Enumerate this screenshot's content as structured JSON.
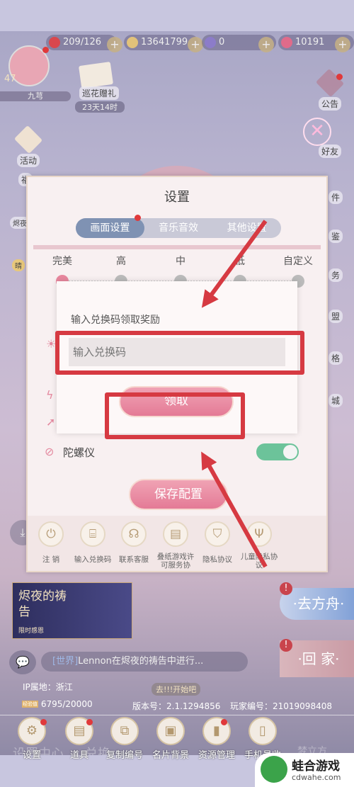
{
  "resources": {
    "stamina": "209/126",
    "gold": "13641799",
    "diamond": "0",
    "crystal": "10191"
  },
  "player": {
    "level": "47",
    "name": "九芎"
  },
  "event": {
    "label": "巡花赠礼",
    "timer": "23天14时"
  },
  "left_menu": [
    "活动",
    "福",
    "烬夜",
    "晴"
  ],
  "right_menu": [
    "公告",
    "好友",
    "件",
    "鉴",
    "务",
    "盟",
    "格",
    "城"
  ],
  "settings": {
    "title": "设置",
    "tabs": [
      "画面设置",
      "音乐音效",
      "其他设置"
    ],
    "active_tab": 0,
    "quality_levels": [
      "完美",
      "高",
      "中",
      "低",
      "自定义"
    ],
    "selected_quality": 0,
    "gyro_label": "陀螺仪",
    "gyro_on": true,
    "save_label": "保存配置",
    "bottom_items": [
      {
        "label": "注 销",
        "icon": "power-icon"
      },
      {
        "label": "输入兑换码",
        "icon": "gift-icon"
      },
      {
        "label": "联系客服",
        "icon": "headset-icon"
      },
      {
        "label": "叠纸游戏许可服务协",
        "icon": "document-icon"
      },
      {
        "label": "隐私协议",
        "icon": "shield-icon"
      },
      {
        "label": "儿童隐私协议",
        "icon": "sprout-icon"
      }
    ]
  },
  "redeem": {
    "title": "输入兑换码领取奖励",
    "placeholder": "输入兑换码",
    "button": "领取"
  },
  "banner": {
    "title": "烬夜的祷告",
    "subtitle": "限时感恩"
  },
  "destinations": {
    "ark": "·去方舟·",
    "home": "·回 家·"
  },
  "chat": {
    "channel": "[世界]",
    "message": "Lennon在烬夜的祷告中进行..."
  },
  "ip": "IP属地：浙江",
  "exp": {
    "badge": "经验值",
    "value": "6795/20000"
  },
  "version": "版本号：2.1.1294856",
  "player_id": "玩家编号：21019098408",
  "center_tag": "去!!!开始吧",
  "bottom_bar": [
    {
      "label": "设置",
      "icon": "gear-icon",
      "badge": true
    },
    {
      "label": "道具",
      "icon": "wallet-icon",
      "badge": true
    },
    {
      "label": "复制编号",
      "icon": "copy-icon",
      "badge": false
    },
    {
      "label": "名片背景",
      "icon": "card-icon",
      "badge": false
    },
    {
      "label": "资源管理",
      "icon": "folder-icon",
      "badge": true
    },
    {
      "label": "手机号收",
      "icon": "phone-icon",
      "badge": false
    }
  ],
  "bg_labels": [
    "设置中心",
    "兑换",
    "梦立方"
  ],
  "watermark": {
    "text": "蛙合游戏",
    "url": "cdwahe.com"
  },
  "colors": {
    "accent": "#e47a96",
    "annotation": "#d63a42",
    "toggle": "#6cc39a",
    "tab_active": "#7f92b3"
  }
}
